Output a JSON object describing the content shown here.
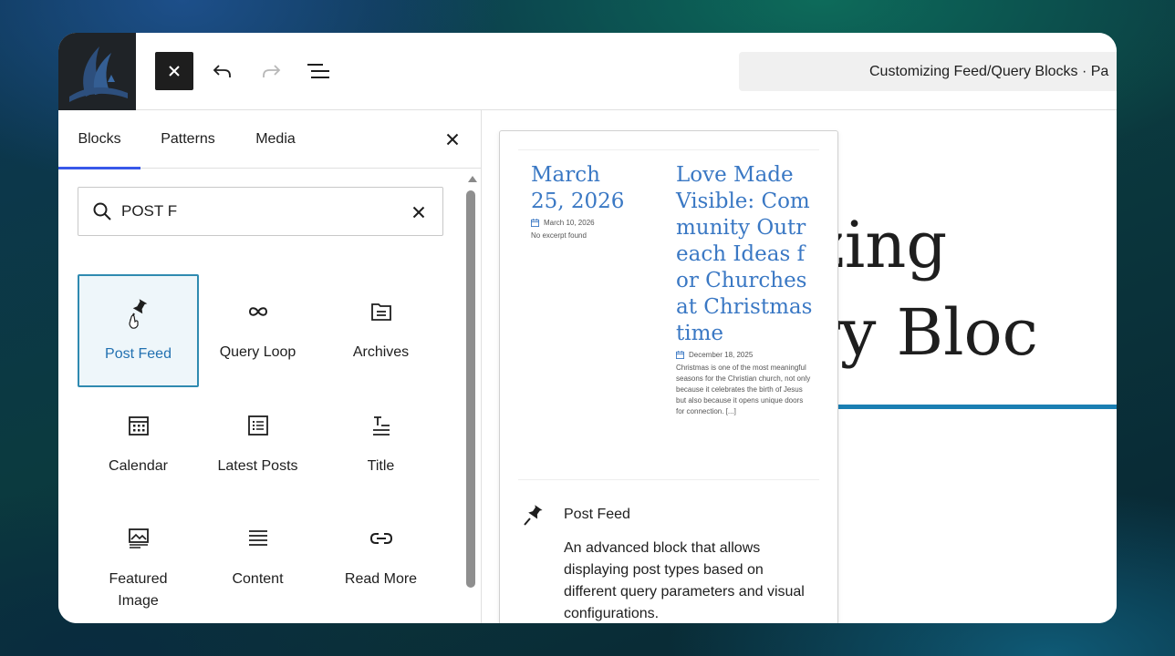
{
  "toolbar": {
    "close_icon": "close-icon",
    "undo_icon": "undo-icon",
    "redo_icon": "redo-icon",
    "outline_icon": "list-view-icon",
    "document_title": "Customizing Feed/Query Blocks · Pa"
  },
  "inserter": {
    "tabs": [
      {
        "label": "Blocks"
      },
      {
        "label": "Patterns"
      },
      {
        "label": "Media"
      }
    ],
    "search": {
      "value": "POST F",
      "placeholder": "Search"
    },
    "blocks": [
      {
        "label": "Post Feed",
        "icon": "pin-icon"
      },
      {
        "label": "Query Loop",
        "icon": "loop-icon"
      },
      {
        "label": "Archives",
        "icon": "archive-icon"
      },
      {
        "label": "Calendar",
        "icon": "calendar-icon"
      },
      {
        "label": "Latest Posts",
        "icon": "list-icon"
      },
      {
        "label": "Title",
        "icon": "title-icon"
      },
      {
        "label": "Featured Image",
        "icon": "image-icon"
      },
      {
        "label": "Content",
        "icon": "content-icon"
      },
      {
        "label": "Read More",
        "icon": "link-icon"
      }
    ]
  },
  "canvas": {
    "title_line1": "zing",
    "title_line2": "ery Bloc"
  },
  "preview": {
    "posts": [
      {
        "title": "March 25, 2026",
        "date": "March 10, 2026",
        "excerpt": "No excerpt found"
      },
      {
        "title": "Love Made Visible: Community Outreach Ideas for Churches at Christmastime",
        "date": "December 18, 2025",
        "excerpt": "Christmas is one of the most meaningful seasons for the Christian church, not only because it celebrates the birth of Jesus but also because it opens unique doors for connection. [...]"
      }
    ],
    "block_name": "Post Feed",
    "block_description": "An advanced block that allows displaying post types based on different query parameters and visual configurations."
  },
  "colors": {
    "accent": "#3858e9",
    "selected_border": "#2f8ab0",
    "post_title": "#3a78c4",
    "canvas_accent_line": "#1a7fb3"
  }
}
